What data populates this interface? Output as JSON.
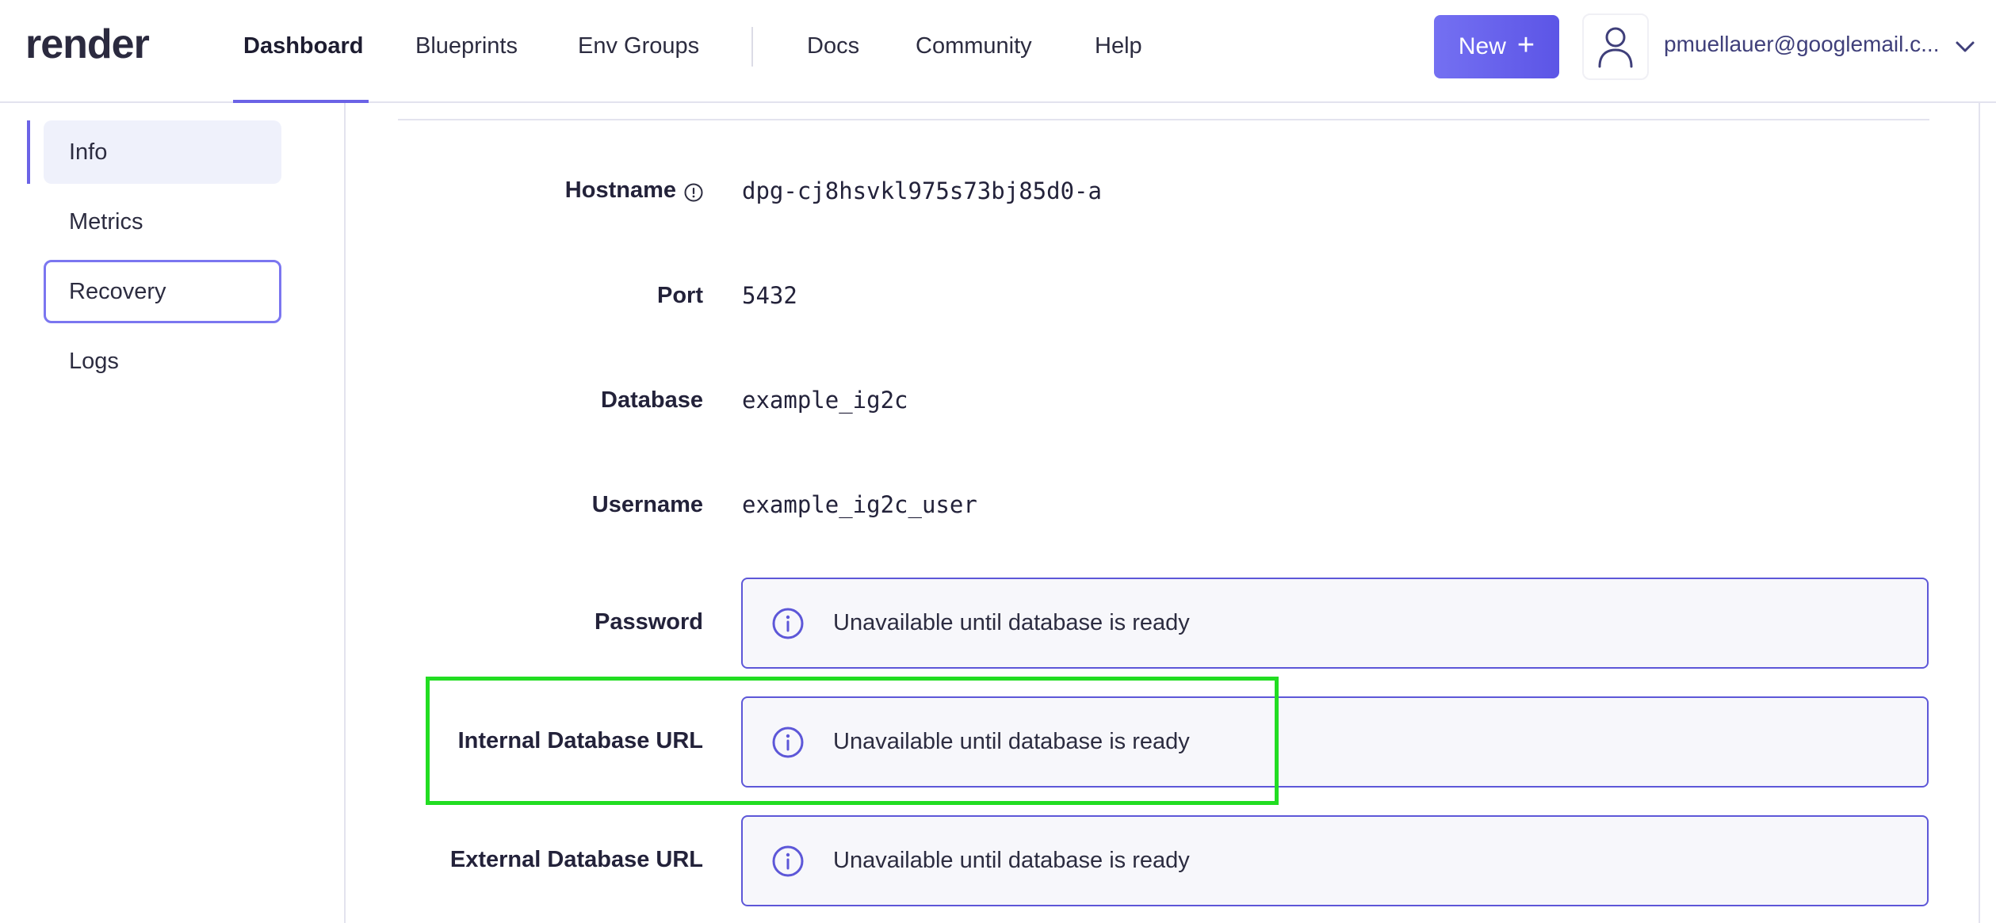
{
  "app": {
    "logo_text": "render"
  },
  "nav": {
    "items": [
      {
        "label": "Dashboard",
        "active": true
      },
      {
        "label": "Blueprints"
      },
      {
        "label": "Env Groups"
      },
      {
        "label": "Docs"
      },
      {
        "label": "Community"
      },
      {
        "label": "Help"
      }
    ],
    "new_button": {
      "label": "New",
      "icon": "plus-icon"
    },
    "user": {
      "email": "pmuellauer@googlemail.c...",
      "avatar_icon": "user-icon",
      "menu_icon": "chevron-down-icon"
    }
  },
  "sidebar": {
    "items": [
      {
        "label": "Info",
        "state": "selected"
      },
      {
        "label": "Metrics"
      },
      {
        "label": "Recovery",
        "state": "focused"
      },
      {
        "label": "Logs"
      }
    ]
  },
  "details": {
    "hostname": {
      "label": "Hostname",
      "value": "dpg-cj8hsvkl975s73bj85d0-a",
      "icon": "help-circle-icon"
    },
    "port": {
      "label": "Port",
      "value": "5432"
    },
    "database": {
      "label": "Database",
      "value": "example_ig2c"
    },
    "username": {
      "label": "Username",
      "value": "example_ig2c_user"
    },
    "password": {
      "label": "Password",
      "message": "Unavailable until database is ready",
      "icon": "info-icon"
    },
    "internal_url": {
      "label": "Internal Database URL",
      "message": "Unavailable until database is ready",
      "icon": "info-icon"
    },
    "external_url": {
      "label": "External Database URL",
      "message": "Unavailable until database is ready",
      "icon": "info-icon"
    }
  },
  "colors": {
    "accent": "#6b63e6",
    "button_gradient_start": "#7470f2",
    "button_gradient_end": "#5c55e6",
    "notice_border": "#5d57d8",
    "notice_bg": "#f7f7fb",
    "highlight": "#22dd22"
  }
}
